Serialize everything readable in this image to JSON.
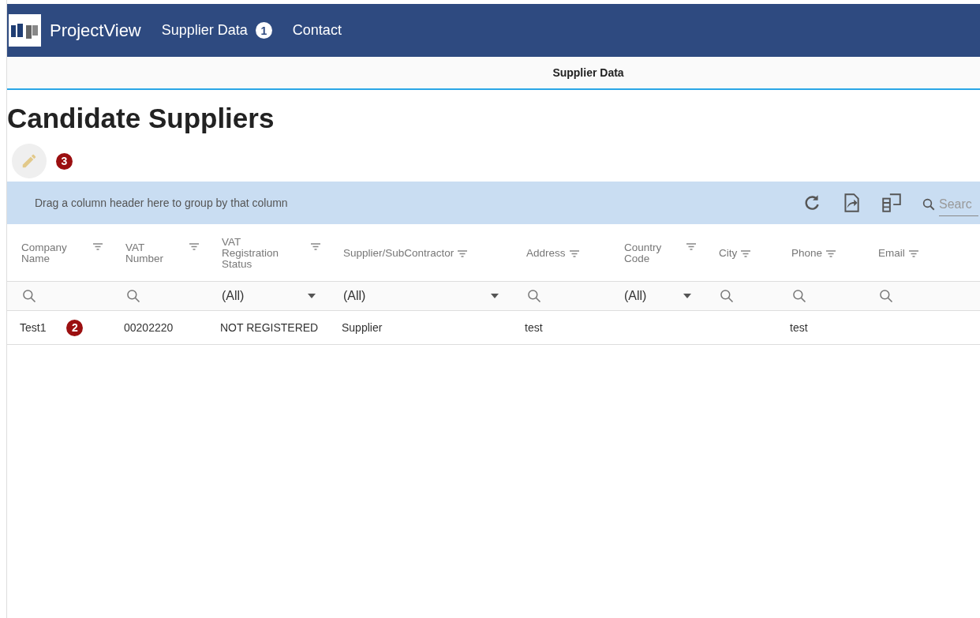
{
  "nav": {
    "brand": "ProjectView",
    "links": [
      {
        "label": "Supplier Data",
        "badge": "1"
      },
      {
        "label": "Contact"
      }
    ]
  },
  "tab": {
    "label": "Supplier Data",
    "selected": true
  },
  "title": "Candidate Suppliers",
  "edit_badge": "3",
  "grid": {
    "group_panel": "Drag a column header here to group by that column",
    "search": {
      "placeholder": "Searc"
    },
    "columns": [
      {
        "label": "Company Name"
      },
      {
        "label": "VAT Number"
      },
      {
        "label": "VAT Registration Status"
      },
      {
        "label": "Supplier/SubContractor"
      },
      {
        "label": "Address"
      },
      {
        "label": "Country Code"
      },
      {
        "label": "City"
      },
      {
        "label": "Phone"
      },
      {
        "label": "Email"
      }
    ],
    "filters": [
      {
        "kind": "search"
      },
      {
        "kind": "search"
      },
      {
        "kind": "select",
        "value": "(All)"
      },
      {
        "kind": "select",
        "value": "(All)"
      },
      {
        "kind": "search"
      },
      {
        "kind": "select",
        "value": "(All)"
      },
      {
        "kind": "search"
      },
      {
        "kind": "search"
      },
      {
        "kind": "search"
      }
    ],
    "rows": [
      {
        "badge": "2",
        "cells": [
          "Test1",
          "00202220",
          "NOT REGISTERED",
          "Supplier",
          "test",
          "",
          "",
          "test",
          ""
        ]
      }
    ]
  }
}
